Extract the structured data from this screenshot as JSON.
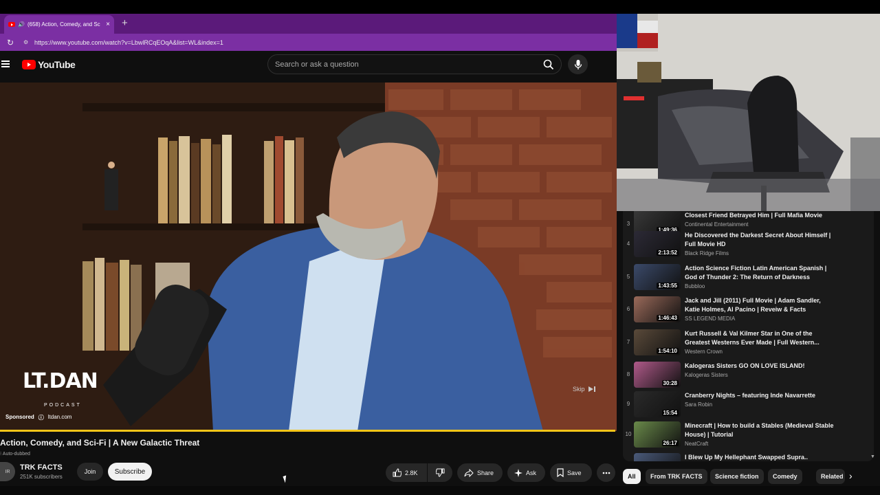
{
  "browser": {
    "tab_title": "(658) Action, Comedy, and Sc",
    "tab_close": "×",
    "new_tab": "+",
    "url": "https://www.youtube.com/watch?v=LbwlRCqEOqA&list=WL&index=1"
  },
  "header": {
    "logo_text": "YouTube",
    "search_placeholder": "Search or ask a question"
  },
  "video": {
    "overlay_logo": "LT.DAN",
    "overlay_podcast": "PODCAST",
    "sponsored_label": "Sponsored",
    "sponsor_domain": "ltdan.com",
    "skip_label": "Skip",
    "title": "Action, Comedy, and Sci-Fi | A New Galactic Threat",
    "auto_dubbed": "Auto-dubbed",
    "channel_name": "TRK FACTS",
    "channel_avatar": "IR",
    "subscribers": "251K subscribers",
    "join_label": "Join",
    "subscribe_label": "Subscribe",
    "like_count": "2.8K",
    "share_label": "Share",
    "ask_label": "Ask",
    "save_label": "Save"
  },
  "playlist": {
    "items": [
      {
        "index": "3",
        "duration": "1:49:36",
        "title": "Closest Friend Betrayed Him | Full Mafia Movie",
        "channel": "Continental Entertainment"
      },
      {
        "index": "4",
        "duration": "2:13:52",
        "title": "He Discovered the Darkest Secret About Himself | Full Movie HD",
        "channel": "Black Ridge Films"
      },
      {
        "index": "5",
        "duration": "1:43:55",
        "title": "Action Science Fiction Latin American Spanish | God of Thunder 2: The Return of Darkness",
        "channel": "Bubbloo"
      },
      {
        "index": "6",
        "duration": "1:46:43",
        "title": "Jack and Jill (2011) Full Movie | Adam Sandler, Katie Holmes, Al Pacino | Reveiw & Facts",
        "channel": "SS LEGEND MEDIA"
      },
      {
        "index": "7",
        "duration": "1:54:10",
        "title": "Kurt Russell & Val Kilmer Star in One of the Greatest Westerns Ever Made | Full Western...",
        "channel": "Western Crown"
      },
      {
        "index": "8",
        "duration": "30:28",
        "title": "Kalogeras Sisters GO ON LOVE ISLAND!",
        "channel": "Kalogeras Sisters"
      },
      {
        "index": "9",
        "duration": "15:54",
        "title": "Cranberry Nights – featuring Inde Navarrette",
        "channel": "Sara Robin"
      },
      {
        "index": "10",
        "duration": "26:17",
        "title": "Minecraft | How to build a Stables (Medieval Stable House) | Tutorial",
        "channel": "NeatCraft"
      },
      {
        "index": "",
        "duration": "",
        "title": "I Blew Up My Hellephant Swapped Supra..",
        "channel": ""
      }
    ],
    "colors": [
      "#3a3a3a",
      "#2c2a36",
      "#3b4a6a",
      "#9a6a5a",
      "#5a4a3a",
      "#b05a8a",
      "#2a2a2a",
      "#6a8a4a",
      "#4a5a7a"
    ]
  },
  "chips": [
    "All",
    "From TRK FACTS",
    "Science fiction",
    "Comedy",
    "Related"
  ],
  "icons": {
    "search": "search-icon",
    "mic": "mic-icon",
    "like": "thumbs-up-icon",
    "dislike": "thumbs-down-icon",
    "share": "share-icon",
    "ask": "sparkle-icon",
    "save": "bookmark-icon",
    "more": "more-icon"
  }
}
